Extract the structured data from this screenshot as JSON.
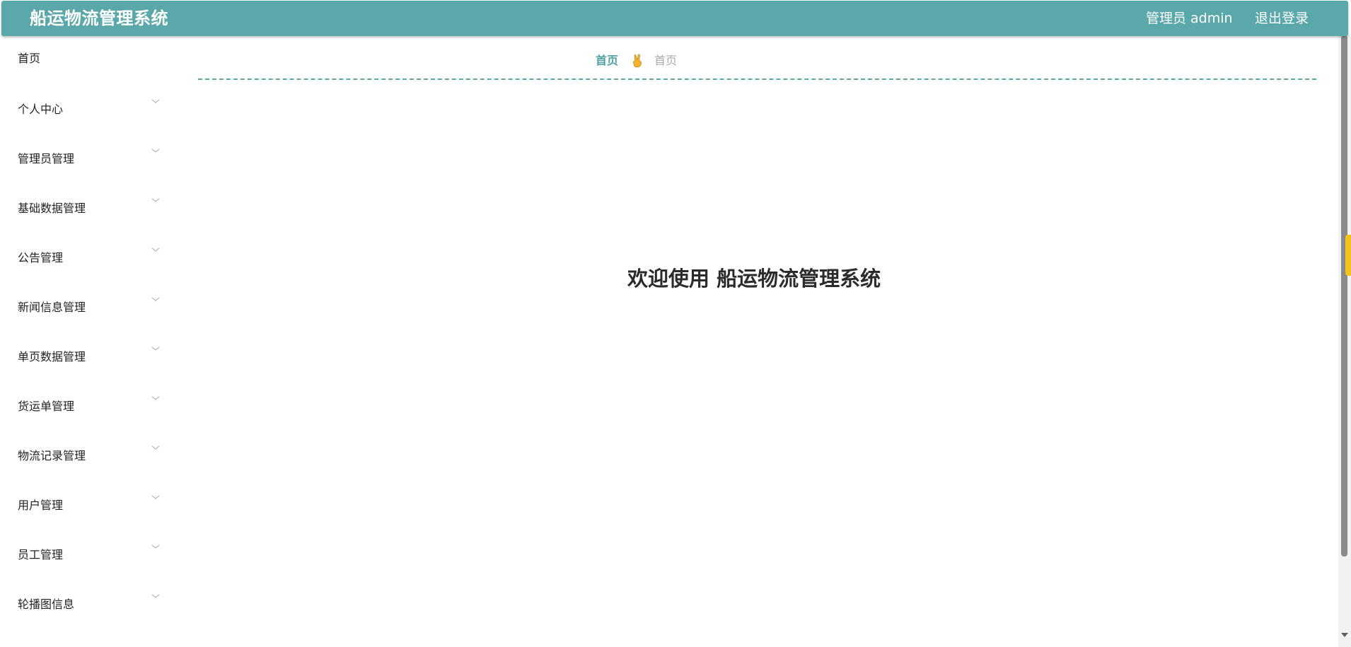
{
  "header": {
    "app_title": "船运物流管理系统",
    "user_label": "管理员 admin",
    "logout_label": "退出登录",
    "bg_color": "#5ba8aa"
  },
  "sidebar": {
    "items": [
      {
        "label": "首页",
        "expandable": false
      },
      {
        "label": "个人中心",
        "expandable": true
      },
      {
        "label": "管理员管理",
        "expandable": true
      },
      {
        "label": "基础数据管理",
        "expandable": true
      },
      {
        "label": "公告管理",
        "expandable": true
      },
      {
        "label": "新闻信息管理",
        "expandable": true
      },
      {
        "label": "单页数据管理",
        "expandable": true
      },
      {
        "label": "货运单管理",
        "expandable": true
      },
      {
        "label": "物流记录管理",
        "expandable": true
      },
      {
        "label": "用户管理",
        "expandable": true
      },
      {
        "label": "员工管理",
        "expandable": true
      },
      {
        "label": "轮播图信息",
        "expandable": true
      }
    ],
    "chevron_icon": "chevron-down-icon"
  },
  "breadcrumb": {
    "home": "首页",
    "separator_icon": "victory-hand-icon",
    "current": "首页",
    "accent_color": "#4f9fa3"
  },
  "main": {
    "welcome_text": "欢迎使用 船运物流管理系统"
  }
}
